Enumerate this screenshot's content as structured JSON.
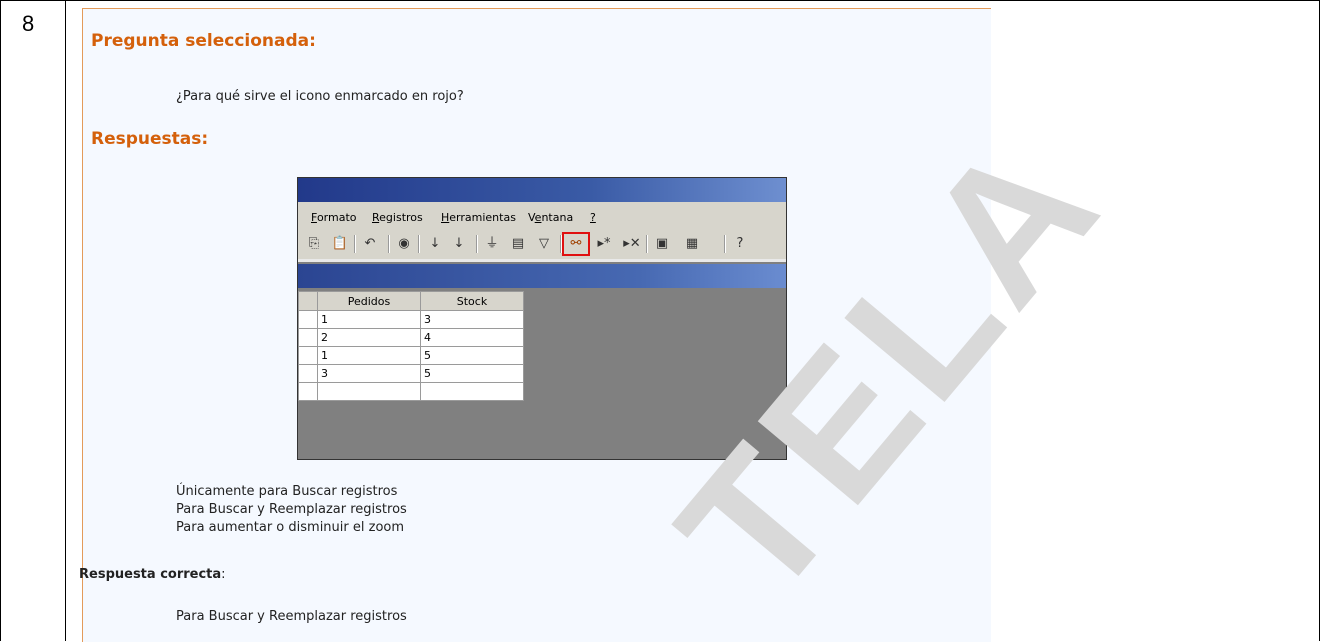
{
  "question_number": "8",
  "panel": {
    "question_heading": "Pregunta seleccionada:",
    "question_text": "¿Para qué sirve el icono enmarcado en rojo?",
    "answers_heading": "Respuestas:",
    "options": [
      "Únicamente para Buscar registros",
      "Para Buscar y Reemplazar registros",
      "Para aumentar o disminuir el zoom"
    ],
    "correct_label": "Respuesta correcta",
    "correct_colon": ":",
    "correct_answer": "Para Buscar y Reemplazar registros"
  },
  "screenshot": {
    "menu": [
      {
        "first": "F",
        "rest": "ormato"
      },
      {
        "first": "R",
        "rest": "egistros"
      },
      {
        "first": "H",
        "rest": "erramientas"
      },
      {
        "first": "Ve",
        "rest": "ntana",
        "underline_index": 1
      },
      {
        "first": "?",
        "rest": ""
      }
    ],
    "toolbar_icons": [
      "copy-icon",
      "paste-icon",
      "undo-icon",
      "hyperlink-icon",
      "sort-ascending-icon",
      "sort-descending-icon",
      "filter-by-selection-icon",
      "filter-by-form-icon",
      "apply-filter-icon",
      "find-binoculars-icon",
      "new-record-icon",
      "delete-record-icon",
      "database-window-icon",
      "new-object-icon",
      "help-icon"
    ],
    "highlighted_icon": "find-binoculars-icon",
    "highlight_color": "#e01010",
    "grid": {
      "columns": [
        "Pedidos",
        "Stock"
      ],
      "rows": [
        [
          "1",
          "3"
        ],
        [
          "2",
          "4"
        ],
        [
          "1",
          "5"
        ],
        [
          "3",
          "5"
        ],
        [
          "",
          ""
        ]
      ]
    }
  },
  "watermark": "TELA",
  "colors": {
    "heading": "#d4600b",
    "panel_bg": "#f5f9ff",
    "panel_border": "#e39b5a"
  }
}
